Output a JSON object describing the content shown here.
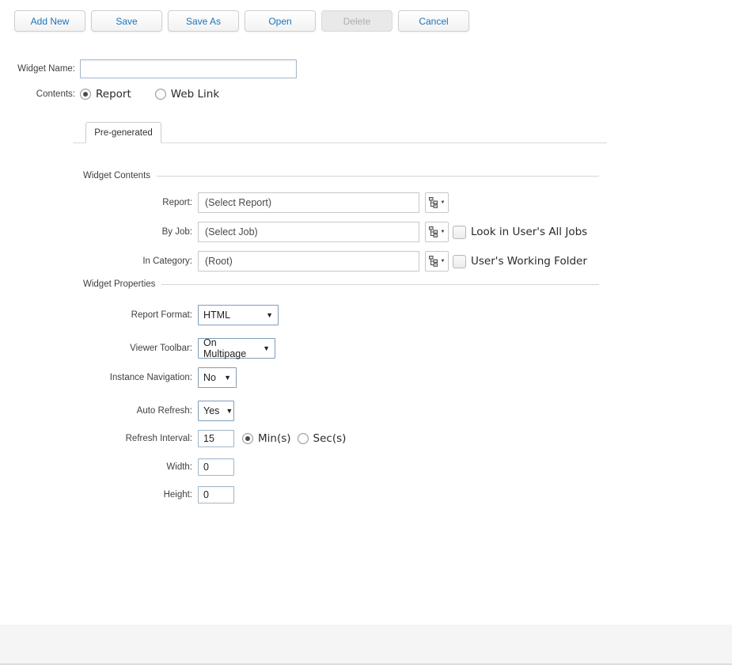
{
  "toolbar": {
    "buttons": [
      {
        "label": "Add New",
        "enabled": true
      },
      {
        "label": "Save",
        "enabled": true
      },
      {
        "label": "Save As",
        "enabled": true
      },
      {
        "label": "Open",
        "enabled": true
      },
      {
        "label": "Delete",
        "enabled": false
      },
      {
        "label": "Cancel",
        "enabled": true
      }
    ]
  },
  "form": {
    "widget_name": {
      "label": "Widget Name:",
      "value": ""
    },
    "contents": {
      "label": "Contents:",
      "options": [
        {
          "label": "Report",
          "selected": true
        },
        {
          "label": "Web Link",
          "selected": false
        }
      ]
    },
    "tab": {
      "label": "Pre-generated",
      "active": true
    }
  },
  "widget_contents": {
    "section_title": "Widget Contents",
    "rows": [
      {
        "label": "Report:",
        "value": "(Select Report)",
        "picker": "tree-picker"
      },
      {
        "label": "By Job:",
        "value": "(Select Job)",
        "picker": "tree-picker",
        "checkbox": {
          "label": "Look in User's All Jobs",
          "checked": false
        }
      },
      {
        "label": "In Category:",
        "value": "(Root)",
        "picker": "tree-picker",
        "checkbox": {
          "label": "User's Working Folder",
          "checked": false
        }
      }
    ]
  },
  "widget_properties": {
    "section_title": "Widget Properties",
    "report_format": {
      "label": "Report Format:",
      "value": "HTML"
    },
    "viewer_toolbar": {
      "label": "Viewer Toolbar:",
      "value": "On Multipage"
    },
    "instance_navigation": {
      "label": "Instance Navigation:",
      "value": "No"
    },
    "auto_refresh": {
      "label": "Auto Refresh:",
      "value": "Yes"
    },
    "refresh_interval": {
      "label": "Refresh Interval:",
      "value": "15",
      "units": [
        {
          "label": "Min(s)",
          "selected": true
        },
        {
          "label": "Sec(s)",
          "selected": false
        }
      ]
    },
    "width": {
      "label": "Width:",
      "value": "0"
    },
    "height": {
      "label": "Height:",
      "value": "0"
    }
  },
  "icons": {
    "dropdown_arrow": "▼",
    "picker_arrow": "▼"
  },
  "colors": {
    "accent_blue": "#1b75bb",
    "border_gray": "#cccccc",
    "select_border": "#7f9db9",
    "label_gray": "#3f3f3f",
    "footer_bg": "#f5f5f6"
  }
}
